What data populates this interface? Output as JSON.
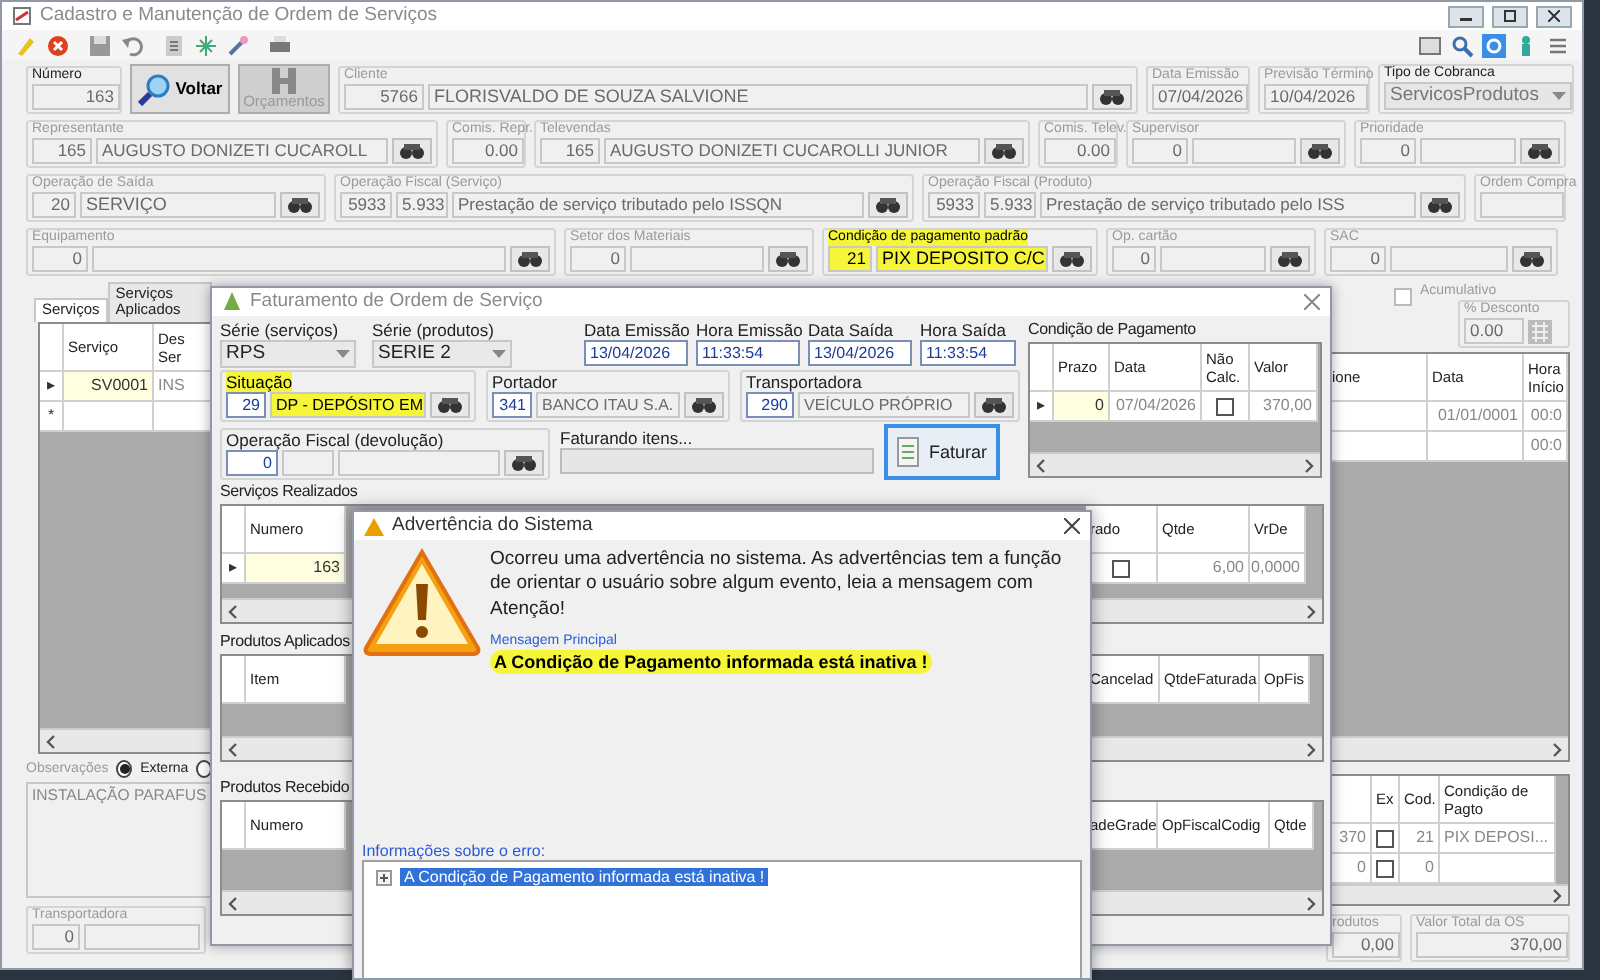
{
  "main_window": {
    "title": "Cadastro e Manutenção de Ordem de Serviços"
  },
  "header_rows": [
    [
      {
        "kind": "field",
        "label": "Número",
        "values": [
          "163"
        ],
        "disabled": false
      },
      {
        "kind": "button",
        "label": "Voltar",
        "disabled": false
      },
      {
        "kind": "button",
        "label": "Orçamentos",
        "disabled": true
      },
      {
        "kind": "field",
        "label": "Cliente",
        "values": [
          "5766",
          "FLORISVALDO DE SOUZA SALVIONE"
        ],
        "lookup": true,
        "disabled": true
      },
      {
        "kind": "field",
        "label": "Data Emissão",
        "values": [
          "07/04/2026"
        ],
        "disabled": true
      },
      {
        "kind": "field",
        "label": "Previsão Término",
        "values": [
          "10/04/2026"
        ],
        "disabled": true
      },
      {
        "kind": "select",
        "label": "Tipo de Cobranca",
        "values": [
          "ServicosProdutos"
        ],
        "disabled": false
      }
    ],
    [
      {
        "kind": "field",
        "label": "Representante",
        "values": [
          "165",
          "AUGUSTO DONIZETI CUCAROLL"
        ],
        "lookup": true,
        "disabled": true
      },
      {
        "kind": "field",
        "label": "Comis. Repr.",
        "values": [
          "0.00"
        ],
        "disabled": true
      },
      {
        "kind": "field",
        "label": "Televendas",
        "values": [
          "165",
          "AUGUSTO DONIZETI CUCAROLLI JUNIOR"
        ],
        "lookup": true,
        "disabled": true
      },
      {
        "kind": "field",
        "label": "Comis. Telev.",
        "values": [
          "0.00"
        ],
        "disabled": true
      },
      {
        "kind": "field",
        "label": "Supervisor",
        "values": [
          "0"
        ],
        "lookup": true,
        "disabled": true
      },
      {
        "kind": "field",
        "label": "Prioridade",
        "values": [
          "0"
        ],
        "lookup": true,
        "disabled": true
      }
    ],
    [
      {
        "kind": "field",
        "label": "Operação de Saída",
        "values": [
          "20",
          "SERVIÇO"
        ],
        "lookup": true,
        "disabled": true
      },
      {
        "kind": "field",
        "label": "Operação Fiscal (Serviço)",
        "values": [
          "5933",
          "5.933",
          "Prestação de serviço tributado pelo ISSQN"
        ],
        "lookup": true,
        "disabled": true
      },
      {
        "kind": "field",
        "label": "Operação Fiscal (Produto)",
        "values": [
          "5933",
          "5.933",
          "Prestação de serviço tributado pelo ISS"
        ],
        "lookup": true,
        "disabled": true
      },
      {
        "kind": "field",
        "label": "Ordem Compra",
        "disabled": true
      }
    ],
    [
      {
        "kind": "field",
        "label": "Equipamento",
        "values": [
          "0"
        ],
        "lookup": true,
        "disabled": true
      },
      {
        "kind": "field",
        "label": "Setor dos Materiais",
        "values": [
          "0"
        ],
        "lookup": true,
        "disabled": true
      },
      {
        "kind": "field",
        "label": "Condição de pagamento padrão",
        "values": [
          "21",
          "PIX DEPOSITO C/C"
        ],
        "lookup": true,
        "disabled": false,
        "highlighted": true
      },
      {
        "kind": "field",
        "label": "Op. cartão",
        "values": [
          "0"
        ],
        "lookup": true,
        "disabled": true
      },
      {
        "kind": "field",
        "label": "SAC",
        "values": [
          "0"
        ],
        "lookup": true,
        "disabled": true
      }
    ]
  ],
  "discount": {
    "accumulate_label": "Acumulativo",
    "accumulate_checked": false,
    "group": {
      "kind": "field",
      "label": "% Desconto",
      "values": [
        "0.00"
      ],
      "disabled": true
    }
  },
  "tabs": [
    {
      "label": "Serviços",
      "selected": true
    },
    {
      "label": "Serviços Aplicados",
      "selected": false
    }
  ],
  "services_grid_left": {
    "columns": [
      "Serviço",
      "Des Ser"
    ],
    "rows": [
      {
        "marker": "▸",
        "selected": true,
        "cells": [
          "SV0001",
          "INS"
        ]
      },
      {
        "marker": "*",
        "selected": false
      }
    ]
  },
  "services_grid_right": {
    "columns": [
      "ione",
      "Data",
      "Hora Início"
    ],
    "rows": [
      {
        "cells": [
          null,
          "01/01/0001",
          "00:0"
        ]
      },
      {
        "cells": [
          null,
          null,
          "00:0"
        ]
      }
    ]
  },
  "notes": {
    "label": "Observações",
    "options": [
      {
        "label": "Externa",
        "selected": true
      },
      {
        "selected": false
      }
    ],
    "text": "INSTALAÇÃO PARAFUS"
  },
  "carrier": {
    "kind": "field",
    "label": "Transportadora",
    "values": [
      "0"
    ],
    "disabled": true
  },
  "payments_grid": {
    "columns": [
      null,
      "Ex",
      "Cod.",
      "Condição de Pagto"
    ],
    "rows": [
      {
        "cells": [
          "370",
          false,
          "21",
          "PIX DEPOSI..."
        ]
      },
      {
        "cells": [
          "0",
          false,
          "0",
          null
        ]
      }
    ]
  },
  "totals": [
    {
      "kind": "field",
      "label": "rodutos",
      "values": [
        "0,00"
      ],
      "disabled": true
    },
    {
      "kind": "field",
      "label": "Valor Total da OS",
      "values": [
        "370,00"
      ],
      "disabled": true
    }
  ],
  "billing_dialog": {
    "title": "Faturamento de Ordem de Serviço",
    "top_row": [
      {
        "kind": "select",
        "label": "Série (serviços)",
        "values": [
          "RPS"
        ]
      },
      {
        "kind": "select",
        "label": "Série (produtos)",
        "values": [
          "SERIE 2"
        ]
      },
      {
        "kind": "field",
        "label": "Data Emissão",
        "values": [
          "13/04/2026"
        ]
      },
      {
        "kind": "field",
        "label": "Hora Emissão",
        "values": [
          "11:33:54"
        ]
      },
      {
        "kind": "field",
        "label": "Data Saída",
        "values": [
          "13/04/2026"
        ]
      },
      {
        "kind": "field",
        "label": "Hora Saída",
        "values": [
          "11:33:54"
        ]
      }
    ],
    "second_row": [
      {
        "kind": "field",
        "label": "Situação",
        "values": [
          "29",
          "DP - DEPÓSITO EM"
        ],
        "lookup": true,
        "highlighted": true
      },
      {
        "kind": "field",
        "label": "Portador",
        "values": [
          "341",
          "BANCO ITAU S.A."
        ],
        "lookup": true,
        "highlighted": false
      },
      {
        "kind": "field",
        "label": "Transportadora",
        "values": [
          "290",
          "VEÍCULO PRÓPRIO"
        ],
        "lookup": true,
        "highlighted": false
      }
    ],
    "fiscal": {
      "kind": "field",
      "label": "Operação Fiscal (devolução)",
      "values": [
        "0"
      ],
      "lookup": true
    },
    "progress": {
      "label": "Faturando itens...",
      "level": 0
    },
    "invoice_button": "Faturar",
    "payment_title": "Condição de Pagamento",
    "payment_grid": {
      "columns": [
        "Prazo",
        "Data",
        "Não Calc.",
        "Valor"
      ],
      "rows": [
        {
          "marker": "▸",
          "selected": true,
          "cells": [
            "0",
            "07/04/2026",
            false,
            "370,00"
          ]
        }
      ]
    },
    "grids": [
      {
        "title": "Serviços Realizados",
        "left": {
          "columns": [
            "Numero"
          ],
          "rows": [
            {
              "marker": "▸",
              "selected": true,
              "cells": [
                "163"
              ]
            }
          ]
        },
        "right": {
          "columns": [
            "rado",
            "Qtde",
            "VrDe"
          ],
          "rows": [
            {
              "cells": [
                false,
                "6,00",
                "0,0000"
              ]
            }
          ]
        }
      },
      {
        "title": "Produtos Aplicados",
        "left": {
          "columns": [
            "Item"
          ]
        },
        "right": {
          "columns": [
            "Cancelad",
            "QtdeFaturada",
            "OpFis"
          ]
        }
      },
      {
        "title": "Produtos Recebido",
        "left": {
          "columns": [
            "Numero"
          ]
        },
        "right": {
          "columns": [
            "adeGrade",
            "OpFiscalCodig",
            "Qtde"
          ]
        }
      }
    ]
  },
  "warning_dialog": {
    "title": "Advertência do Sistema",
    "intro": "Ocorreu uma advertência no sistema. As advertências tem a função de orientar o usuário sobre algum evento, leia a mensagem com Atenção!",
    "main_label": "Mensagem Principal",
    "main_message": "A Condição de Pagamento informada está inativa !",
    "highlighted": true,
    "details_label": "Informações sobre o erro:",
    "details": [
      {
        "label": "A Condição de Pagamento informada está inativa !",
        "selected": true,
        "expanded": false
      }
    ]
  }
}
